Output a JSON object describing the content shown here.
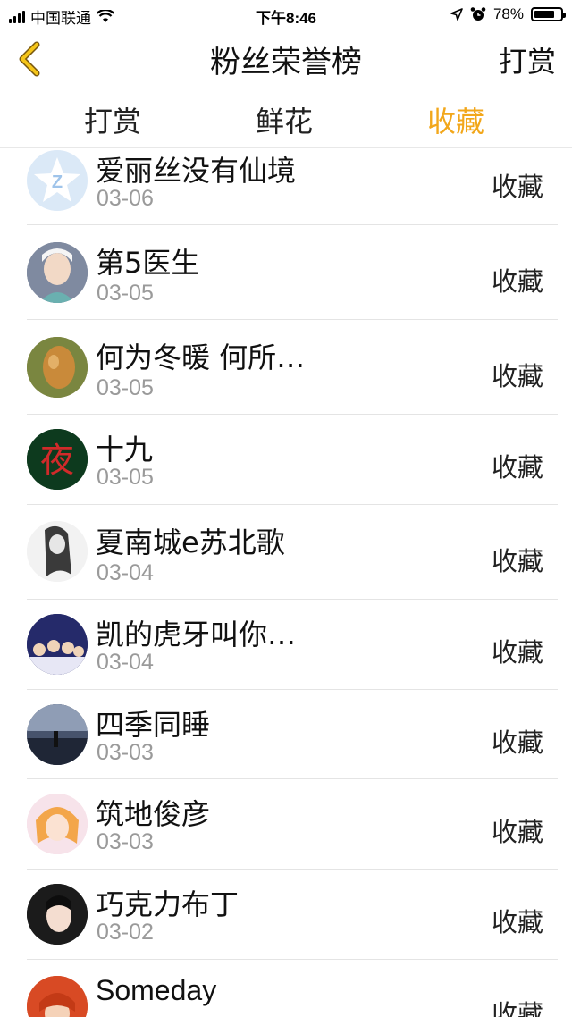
{
  "status_bar": {
    "carrier": "中国联通",
    "time": "下午8:46",
    "battery": "78%",
    "battery_level": 0.78
  },
  "nav": {
    "back_icon": "chevron-left-icon",
    "title": "粉丝荣誉榜",
    "right_label": "打赏"
  },
  "tabs": [
    {
      "label": "打赏"
    },
    {
      "label": "鲜花"
    },
    {
      "label": "收藏"
    }
  ],
  "active_tab_color": "#f2a71b",
  "rows": [
    {
      "name": "爱丽丝没有仙境",
      "date": "03-06",
      "action": "收藏"
    },
    {
      "name": "第5医生",
      "date": "03-05",
      "action": "收藏"
    },
    {
      "name": "何为冬暖 何所…",
      "date": "03-05",
      "action": "收藏"
    },
    {
      "name": "十九",
      "date": "03-05",
      "action": "收藏"
    },
    {
      "name": "夏南城e苏北歌",
      "date": "03-04",
      "action": "收藏"
    },
    {
      "name": "凯的虎牙叫你…",
      "date": "03-04",
      "action": "收藏"
    },
    {
      "name": "四季同睡",
      "date": "03-03",
      "action": "收藏"
    },
    {
      "name": "筑地俊彦",
      "date": "03-03",
      "action": "收藏"
    },
    {
      "name": "巧克力布丁",
      "date": "03-02",
      "action": "收藏"
    },
    {
      "name": "Someday",
      "date": "",
      "action": "收藏"
    }
  ]
}
